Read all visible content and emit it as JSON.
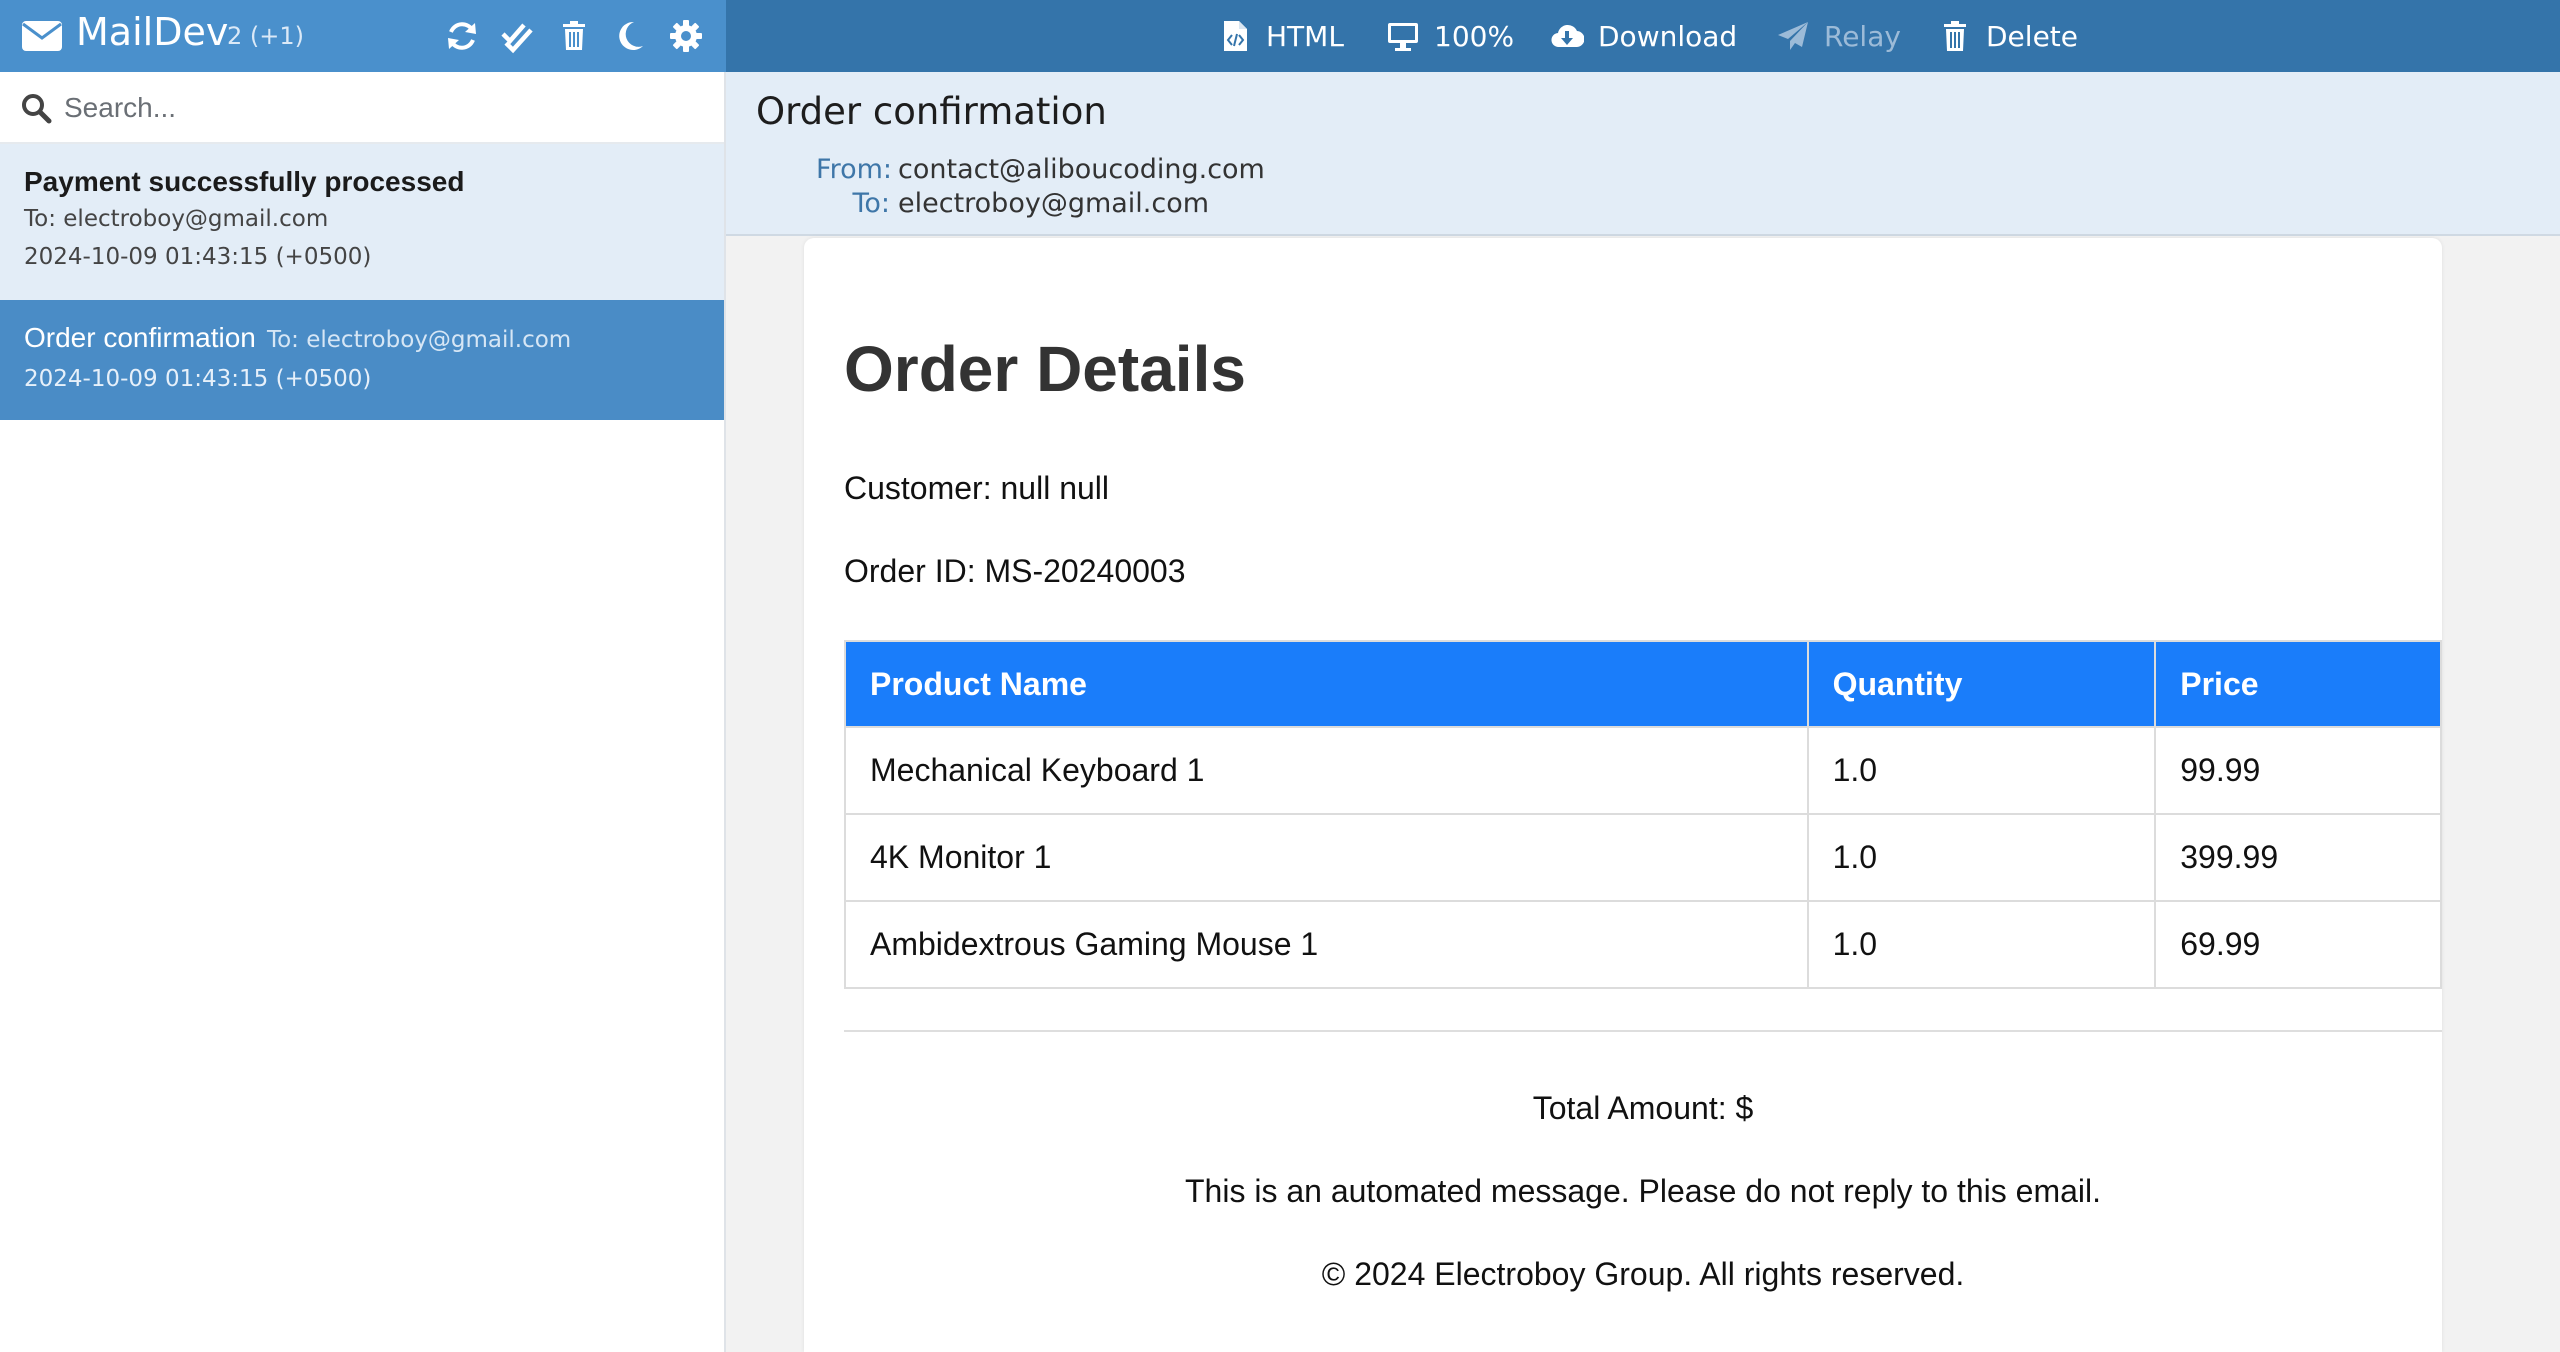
{
  "app": {
    "name": "MailDev",
    "count": "2 (+1)"
  },
  "sidebar": {
    "tools": [
      "refresh-icon",
      "mark-all-read-icon",
      "delete-all-icon",
      "dark-mode-icon",
      "settings-icon"
    ],
    "search": {
      "placeholder": "Search...",
      "value": ""
    },
    "emails": [
      {
        "subject": "Payment successfully processed",
        "to": "To: electroboy@gmail.com",
        "date": "2024-10-09 01:43:15 (+0500)",
        "selected": false
      },
      {
        "subject": "Order confirmation",
        "to": "To: electroboy@gmail.com",
        "date": "2024-10-09 01:43:15 (+0500)",
        "selected": true
      }
    ]
  },
  "toolbar": {
    "html_label": "HTML",
    "zoom_label": "100%",
    "download_label": "Download",
    "relay_label": "Relay",
    "delete_label": "Delete"
  },
  "email": {
    "subject": "Order confirmation",
    "from_key": "From:",
    "from": "contact@aliboucoding.com",
    "to_key": "To:",
    "to": "electroboy@gmail.com",
    "body": {
      "title": "Order Details",
      "customer": "Customer: null null",
      "order_id": "Order ID: MS-20240003",
      "table": {
        "headers": [
          "Product Name",
          "Quantity",
          "Price"
        ],
        "rows": [
          [
            "Mechanical Keyboard 1",
            "1.0",
            "99.99"
          ],
          [
            "4K Monitor 1",
            "1.0",
            "399.99"
          ],
          [
            "Ambidextrous Gaming Mouse 1",
            "1.0",
            "69.99"
          ]
        ]
      },
      "total": "Total Amount: $",
      "notice": "This is an automated message. Please do not reply to this email.",
      "copyright": "© 2024 Electroboy Group. All rights reserved."
    }
  },
  "colors": {
    "sidebar_header": "#4a90cc",
    "toolbar": "#3474aa",
    "selected_item": "#4a8cc6",
    "unselected_item": "#e3edf7",
    "table_header": "#1a7dfa"
  }
}
